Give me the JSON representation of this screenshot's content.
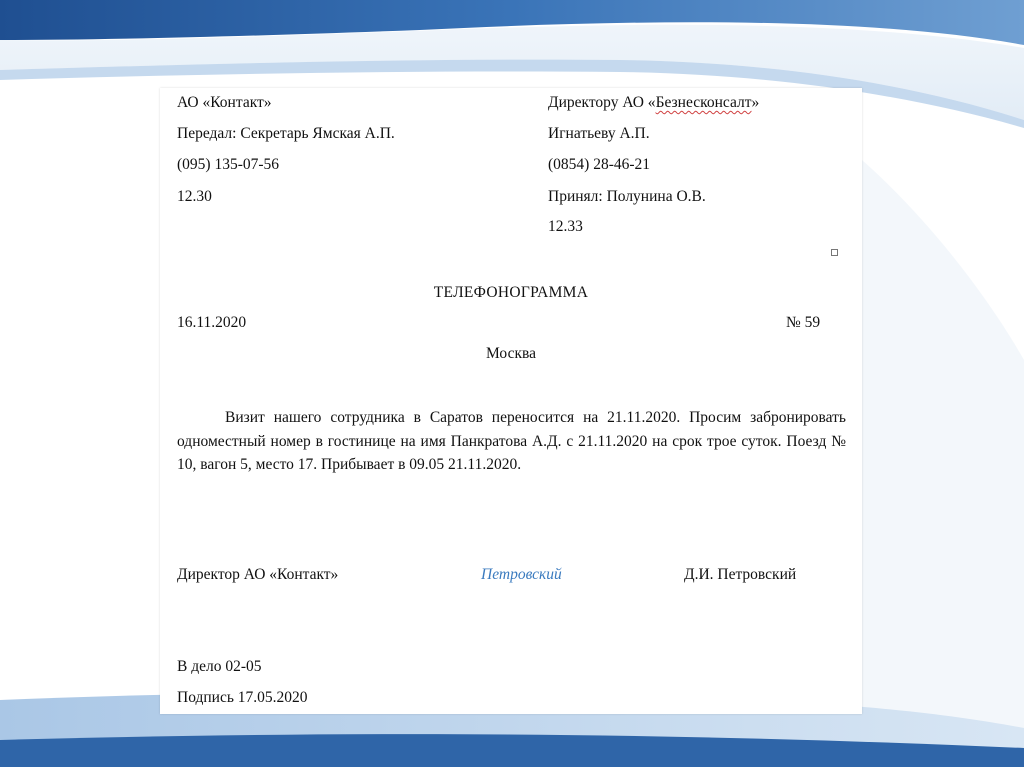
{
  "header": {
    "left": {
      "org": "АО «Контакт»",
      "sender": "Передал: Секретарь Ямская А.П.",
      "phone": "(095) 135-07-56",
      "time": "12.30"
    },
    "right": {
      "recipient_prefix": "Директору АО «",
      "recipient_org": "Безнесконсалт",
      "recipient_suffix": "»",
      "recipient_name": "Игнатьеву А.П.",
      "phone": "(0854) 28-46-21",
      "receiver": "Принял: Полунина О.В.",
      "time": "12.33"
    }
  },
  "document": {
    "title": "ТЕЛЕФОНОГРАММА",
    "date": "16.11.2020",
    "number": "№ 59",
    "city": "Москва",
    "body": "Визит нашего сотрудника в Саратов переносится на 21.11.2020. Просим забронировать одноместный номер в гостинице на имя Панкратова А.Д. с 21.11.2020 на срок трое суток. Поезд № 10, вагон 5, место 17. Прибывает в 09.05 21.11.2020."
  },
  "signature": {
    "position": "Директор АО «Контакт»",
    "handwritten": "Петровский",
    "name": "Д.И. Петровский"
  },
  "footer": {
    "file_note": "В дело 02-05",
    "signed": "Подпись 17.05.2020"
  },
  "colors": {
    "signature_blue": "#3b7bbf",
    "slide_blue_dark": "#2a5d9f",
    "slide_blue_light": "#c9dbef"
  }
}
